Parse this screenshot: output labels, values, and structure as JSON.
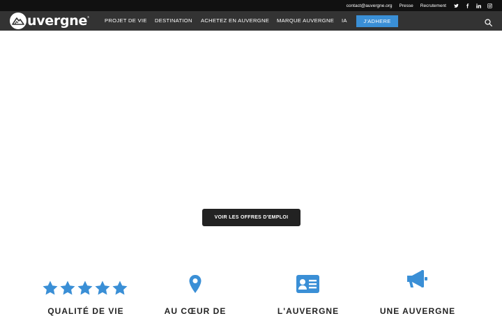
{
  "topbar": {
    "email": "contact@auvergne.org",
    "press": "Presse",
    "jobs": "Recrutement",
    "social": [
      "twitter-icon",
      "facebook-icon",
      "linkedin-icon",
      "instagram-icon"
    ]
  },
  "nav": {
    "logo": "uvergne",
    "items": [
      "PROJET DE VIE",
      "DESTINATION",
      "ACHETEZ EN AUVERGNE",
      "MARQUE AUVERGNE",
      "IA"
    ],
    "cta": "J'ADHERE"
  },
  "main": {
    "button": "VOIR LES OFFRES D'EMPLOI"
  },
  "features": {
    "titles": [
      "QUALITÉ DE VIE",
      "AU CŒUR DE",
      "L'AUVERGNE",
      "UNE AUVERGNE"
    ]
  },
  "colors": {
    "accent": "#3a8fd6",
    "topbar": "#111111",
    "navbar": "#333333"
  }
}
